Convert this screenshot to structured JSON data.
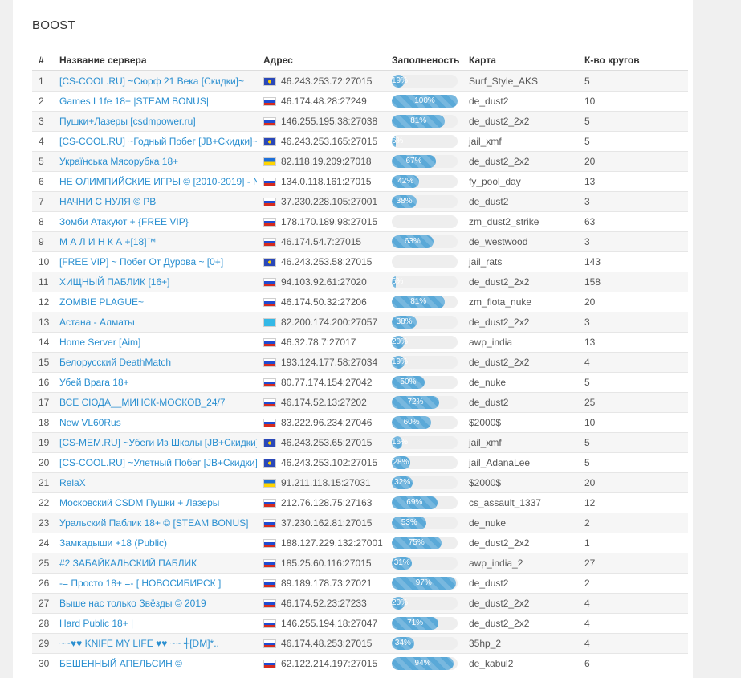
{
  "page_title": "BOOST",
  "columns": [
    "#",
    "Название сервера",
    "Адрес",
    "Заполненость",
    "Карта",
    "К-во кругов"
  ],
  "rows": [
    {
      "num": "1",
      "name": "[CS-COOL.RU] ~Сюрф 21 Века [Скидки]~",
      "flag": "eu",
      "addr": "46.243.253.72:27015",
      "fill": 19,
      "fill_label": "19%",
      "map": "Surf_Style_AKS",
      "rounds": "5"
    },
    {
      "num": "2",
      "name": "Games L1fe 18+ |STEAM BONUS|",
      "flag": "ru",
      "addr": "46.174.48.28:27249",
      "fill": 100,
      "fill_label": "100%",
      "map": "de_dust2",
      "rounds": "10"
    },
    {
      "num": "3",
      "name": "Пушки+Лазеры [csdmpower.ru]",
      "flag": "ru",
      "addr": "146.255.195.38:27038",
      "fill": 81,
      "fill_label": "81%",
      "map": "de_dust2_2x2",
      "rounds": "5"
    },
    {
      "num": "4",
      "name": "[CS-COOL.RU] ~Годный Побег [JB+Скидки]~",
      "flag": "eu",
      "addr": "46.243.253.165:27015",
      "fill": 6,
      "fill_label": "6%",
      "map": "jail_xmf",
      "rounds": "5"
    },
    {
      "num": "5",
      "name": "Українська Мясорубка 18+",
      "flag": "ua",
      "addr": "82.118.19.209:27018",
      "fill": 67,
      "fill_label": "67%",
      "map": "de_dust2_2x2",
      "rounds": "20"
    },
    {
      "num": "6",
      "name": "НЕ ОЛИМПИЙСКИЕ ИГРЫ © [2010-2019] - NEW",
      "flag": "ru",
      "addr": "134.0.118.161:27015",
      "fill": 42,
      "fill_label": "42%",
      "map": "fy_pool_day",
      "rounds": "13"
    },
    {
      "num": "7",
      "name": "НАЧНИ С НУЛЯ © PB",
      "flag": "ru",
      "addr": "37.230.228.105:27001",
      "fill": 38,
      "fill_label": "38%",
      "map": "de_dust2",
      "rounds": "3"
    },
    {
      "num": "8",
      "name": "Зомби Атакуют + {FREE VIP}",
      "flag": "ru",
      "addr": "178.170.189.98:27015",
      "fill": 0,
      "fill_label": "",
      "map": "zm_dust2_strike",
      "rounds": "63"
    },
    {
      "num": "9",
      "name": "М А Л И Н К А +[18]™",
      "flag": "ru",
      "addr": "46.174.54.7:27015",
      "fill": 63,
      "fill_label": "63%",
      "map": "de_westwood",
      "rounds": "3"
    },
    {
      "num": "10",
      "name": "[FREE VIP] ~ Побег От Дурова ~ [0+]",
      "flag": "eu",
      "addr": "46.243.253.58:27015",
      "fill": 0,
      "fill_label": "",
      "map": "jail_rats",
      "rounds": "143"
    },
    {
      "num": "11",
      "name": "ХИЩНЫЙ ПАБЛИК [16+]",
      "flag": "ru",
      "addr": "94.103.92.61:27020",
      "fill": 6,
      "fill_label": "6%",
      "map": "de_dust2_2x2",
      "rounds": "158"
    },
    {
      "num": "12",
      "name": "ZOMBIE PLAGUE~",
      "flag": "ru",
      "addr": "46.174.50.32:27206",
      "fill": 81,
      "fill_label": "81%",
      "map": "zm_flota_nuke",
      "rounds": "20"
    },
    {
      "num": "13",
      "name": "Астана - Алматы",
      "flag": "kz",
      "addr": "82.200.174.200:27057",
      "fill": 38,
      "fill_label": "38%",
      "map": "de_dust2_2x2",
      "rounds": "3"
    },
    {
      "num": "14",
      "name": "Home Server [Aim]",
      "flag": "ru",
      "addr": "46.32.78.7:27017",
      "fill": 20,
      "fill_label": "20%",
      "map": "awp_india",
      "rounds": "13"
    },
    {
      "num": "15",
      "name": "Белорусский DeathMatch",
      "flag": "ru",
      "addr": "193.124.177.58:27034",
      "fill": 19,
      "fill_label": "19%",
      "map": "de_dust2_2x2",
      "rounds": "4"
    },
    {
      "num": "16",
      "name": "Убей Врага 18+",
      "flag": "ru",
      "addr": "80.77.174.154:27042",
      "fill": 50,
      "fill_label": "50%",
      "map": "de_nuke",
      "rounds": "5"
    },
    {
      "num": "17",
      "name": "ВСЕ СЮДА__МИНСК-МОСКОВ_24/7",
      "flag": "ru",
      "addr": "46.174.52.13:27202",
      "fill": 72,
      "fill_label": "72%",
      "map": "de_dust2",
      "rounds": "25"
    },
    {
      "num": "18",
      "name": "New VL60Rus",
      "flag": "ru",
      "addr": "83.222.96.234:27046",
      "fill": 60,
      "fill_label": "60%",
      "map": "$2000$",
      "rounds": "10"
    },
    {
      "num": "19",
      "name": "[CS-MEM.RU] ~Убеги Из Школы [JB+Скидки]~..",
      "flag": "eu",
      "addr": "46.243.253.65:27015",
      "fill": 16,
      "fill_label": "16%",
      "map": "jail_xmf",
      "rounds": "5"
    },
    {
      "num": "20",
      "name": "[CS-COOL.RU] ~Улетный Побег [JB+Скидки]~..",
      "flag": "eu",
      "addr": "46.243.253.102:27015",
      "fill": 28,
      "fill_label": "28%",
      "map": "jail_AdanaLee",
      "rounds": "5"
    },
    {
      "num": "21",
      "name": "RelaX",
      "flag": "ua",
      "addr": "91.211.118.15:27031",
      "fill": 32,
      "fill_label": "32%",
      "map": "$2000$",
      "rounds": "20"
    },
    {
      "num": "22",
      "name": "Московский CSDM Пушки + Лазеры",
      "flag": "ru",
      "addr": "212.76.128.75:27163",
      "fill": 69,
      "fill_label": "69%",
      "map": "cs_assault_1337",
      "rounds": "12"
    },
    {
      "num": "23",
      "name": "Уральский Паблик 18+ © [STEAM BONUS]",
      "flag": "ru",
      "addr": "37.230.162.81:27015",
      "fill": 53,
      "fill_label": "53%",
      "map": "de_nuke",
      "rounds": "2"
    },
    {
      "num": "24",
      "name": "Замкадыши +18 (Public)",
      "flag": "ru",
      "addr": "188.127.229.132:27001",
      "fill": 75,
      "fill_label": "75%",
      "map": "de_dust2_2x2",
      "rounds": "1"
    },
    {
      "num": "25",
      "name": "#2 ЗАБАЙКАЛЬСКИЙ ПАБЛИК",
      "flag": "ru",
      "addr": "185.25.60.116:27015",
      "fill": 31,
      "fill_label": "31%",
      "map": "awp_india_2",
      "rounds": "27"
    },
    {
      "num": "26",
      "name": "-= Просто 18+ =- [ НОВОСИБИРСК ]",
      "flag": "ru",
      "addr": "89.189.178.73:27021",
      "fill": 97,
      "fill_label": "97%",
      "map": "de_dust2",
      "rounds": "2"
    },
    {
      "num": "27",
      "name": "Выше нас только Звёзды © 2019",
      "flag": "ru",
      "addr": "46.174.52.23:27233",
      "fill": 20,
      "fill_label": "20%",
      "map": "de_dust2_2x2",
      "rounds": "4"
    },
    {
      "num": "28",
      "name": "Hard Public 18+ |",
      "flag": "ru",
      "addr": "146.255.194.18:27047",
      "fill": 71,
      "fill_label": "71%",
      "map": "de_dust2_2x2",
      "rounds": "4"
    },
    {
      "num": "29",
      "name": "~~♥♥ KNIFE MY LIFE ♥♥ ~~ ┽[DM]*..",
      "flag": "ru",
      "addr": "46.174.48.253:27015",
      "fill": 34,
      "fill_label": "34%",
      "map": "35hp_2",
      "rounds": "4"
    },
    {
      "num": "30",
      "name": "БЕШЕННЫЙ АПЕЛЬСИН ©",
      "flag": "ru",
      "addr": "62.122.214.197:27015",
      "fill": 94,
      "fill_label": "94%",
      "map": "de_kabul2",
      "rounds": "6"
    }
  ]
}
